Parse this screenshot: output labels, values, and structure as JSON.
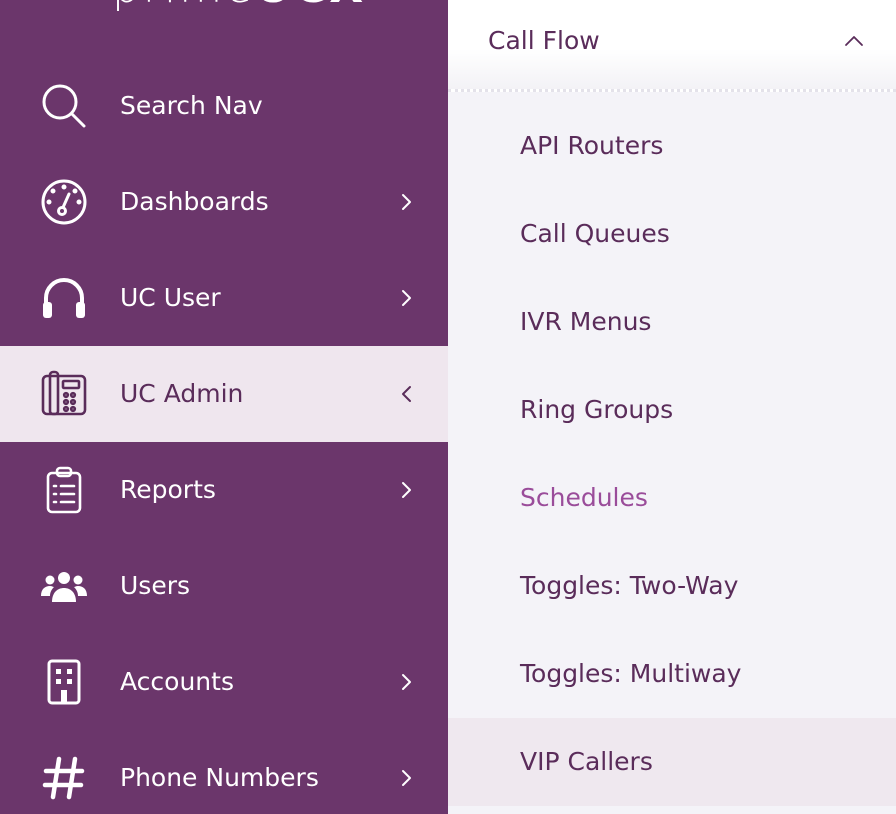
{
  "brand": {
    "logo_light": "prime",
    "logo_bold": "UCX"
  },
  "colors": {
    "sidebar_bg": "#6b366b",
    "active_bg": "#efe6ee",
    "submenu_bg": "#f4f3f8",
    "text_dark": "#5a2c5a",
    "text_current": "#9a4c9a"
  },
  "sidebar": {
    "items": [
      {
        "label": "Search Nav",
        "icon": "search-icon",
        "chevron": "none"
      },
      {
        "label": "Dashboards",
        "icon": "gauge-icon",
        "chevron": "right"
      },
      {
        "label": "UC User",
        "icon": "headset-icon",
        "chevron": "right"
      },
      {
        "label": "UC Admin",
        "icon": "desk-phone-icon",
        "chevron": "left",
        "active": true
      },
      {
        "label": "Reports",
        "icon": "clipboard-icon",
        "chevron": "right"
      },
      {
        "label": "Users",
        "icon": "users-icon",
        "chevron": "none"
      },
      {
        "label": "Accounts",
        "icon": "building-icon",
        "chevron": "right"
      },
      {
        "label": "Phone Numbers",
        "icon": "hashtag-icon",
        "chevron": "right"
      }
    ]
  },
  "submenu": {
    "title": "Call Flow",
    "expanded": true,
    "items": [
      {
        "label": "API Routers"
      },
      {
        "label": "Call Queues"
      },
      {
        "label": "IVR Menus"
      },
      {
        "label": "Ring Groups"
      },
      {
        "label": "Schedules",
        "current": true
      },
      {
        "label": "Toggles: Two-Way"
      },
      {
        "label": "Toggles: Multiway"
      },
      {
        "label": "VIP Callers",
        "hover": true
      }
    ]
  }
}
